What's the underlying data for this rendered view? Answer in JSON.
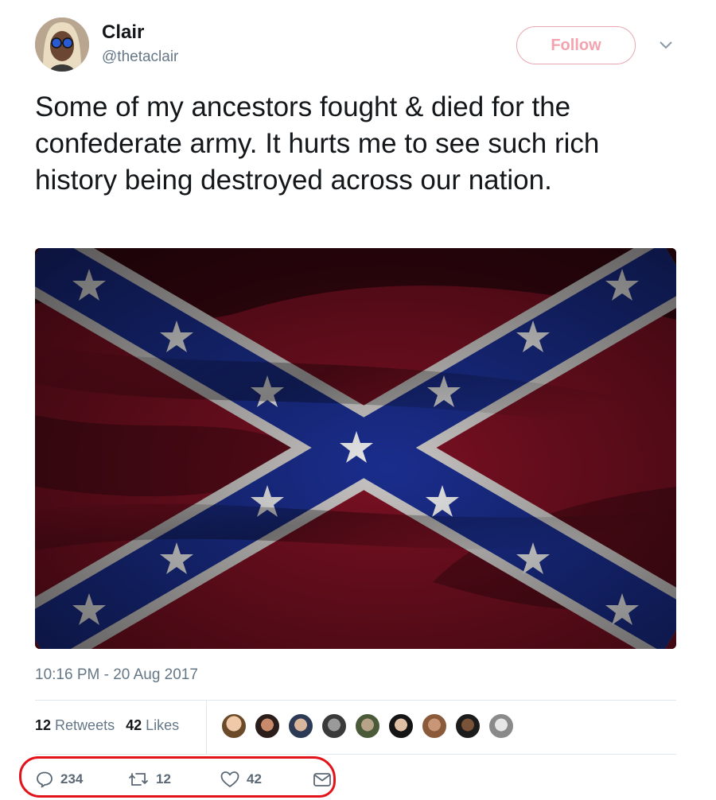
{
  "user": {
    "name": "Clair",
    "handle": "@thetaclair"
  },
  "follow_label": "Follow",
  "tweet": {
    "text": "Some of my ancestors fought & died for the confederate army. It hurts me to see such rich history being destroyed across our nation.",
    "timestamp": "10:16 PM - 20 Aug 2017"
  },
  "stats": {
    "retweets_count": "12",
    "retweets_label": "Retweets",
    "likes_count": "42",
    "likes_label": "Likes"
  },
  "actions": {
    "replies": "234",
    "retweets": "12",
    "likes": "42"
  },
  "colors": {
    "follow": "#f3a3ad",
    "flag_red": "#7a1022",
    "flag_blue": "#1a2d8c",
    "highlight": "#e3131a"
  }
}
